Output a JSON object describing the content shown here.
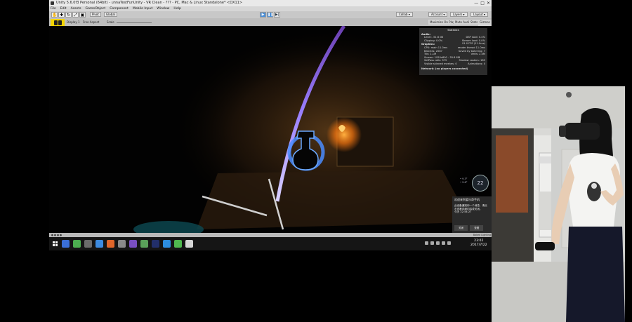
{
  "window": {
    "title": "Unity 5.6.0f3 Personal (64bit) - unnaTestFunUnity - VR Clean - ??? - PC, Mac & Linux Standalone* <DX11>",
    "controls": [
      "—",
      "□",
      "✕"
    ]
  },
  "menu": [
    "File",
    "Edit",
    "Assets",
    "GameObject",
    "Component",
    "Mobile Input",
    "Window",
    "Help"
  ],
  "toolbar": {
    "tools": [
      "✋",
      "✚",
      "↻",
      "⤢",
      "▣"
    ],
    "pivot": "Pivot",
    "global": "Global",
    "play_buttons": [
      "▶",
      "❚❚",
      "▶|"
    ],
    "collab": "Collab ▾",
    "account": "Account ▾",
    "layers": "Layers ▾",
    "layout": "Layout ▾"
  },
  "game_view": {
    "display": "Display 1",
    "aspect": "Free Aspect",
    "scale_label": "Scale",
    "right_buttons": [
      "Maximize On Play",
      "Mute Audio",
      "Stats",
      "Gizmos ▾"
    ]
  },
  "stats": {
    "title": "Statistics",
    "audio_label": "Audio:",
    "audio_rows": [
      [
        "Level: -51.6 dB",
        "DSP load: 0.4%"
      ],
      [
        "Clipping: 0.0%",
        "Stream load: 0.0%"
      ]
    ],
    "graphics_label": "Graphics:",
    "fps": "91.0 FPS (11.0ms)",
    "graphics_rows": [
      [
        "CPU: main 11.0ms",
        "render thread 11.0ms"
      ],
      [
        "Batches: 2087",
        "Saved by batching: 7"
      ],
      [
        "Tris: 1.1M",
        "Verts: 2.0M"
      ],
      [
        "Screen: 1920x800 - 35.8 MB",
        ""
      ],
      [
        "SetPass calls: 375",
        "Shadow casters: 185"
      ],
      [
        "Visible skinned meshes: 0",
        "Animations: 0"
      ]
    ],
    "network": "Network: (no players connected)"
  },
  "overlay": {
    "clock_value": "22",
    "mini_lines": [
      "• 9.3°",
      "• 9.6°"
    ]
  },
  "notification": {
    "title": "欢迎来到爱乐奇手机",
    "body": "此设备通知你一个消息，请点击查看详细内容或关闭。",
    "time": "今天 22:54:27",
    "buttons": [
      "关闭",
      "查看"
    ]
  },
  "statusbar": {
    "left": "● ● ● ●",
    "right": "Baked Lighting"
  },
  "taskbar": {
    "time": "23:02",
    "date": "2017/7/22",
    "task_colors": [
      "#3a6fd8",
      "#4caf50",
      "#6b6b6b",
      "#3d8be0",
      "#e0662a",
      "#8a8a8a",
      "#7a4fc2",
      "#5aa05a",
      "#222f6a",
      "#2d8ee0",
      "#4fb84f",
      "#d6d6d6"
    ]
  },
  "colors": {
    "gizmo_yellow": "#f2d400",
    "laser_purple": "#8a6bff",
    "glow_blue": "#4a8cff",
    "lamp_orange": "#ff8a1a"
  }
}
